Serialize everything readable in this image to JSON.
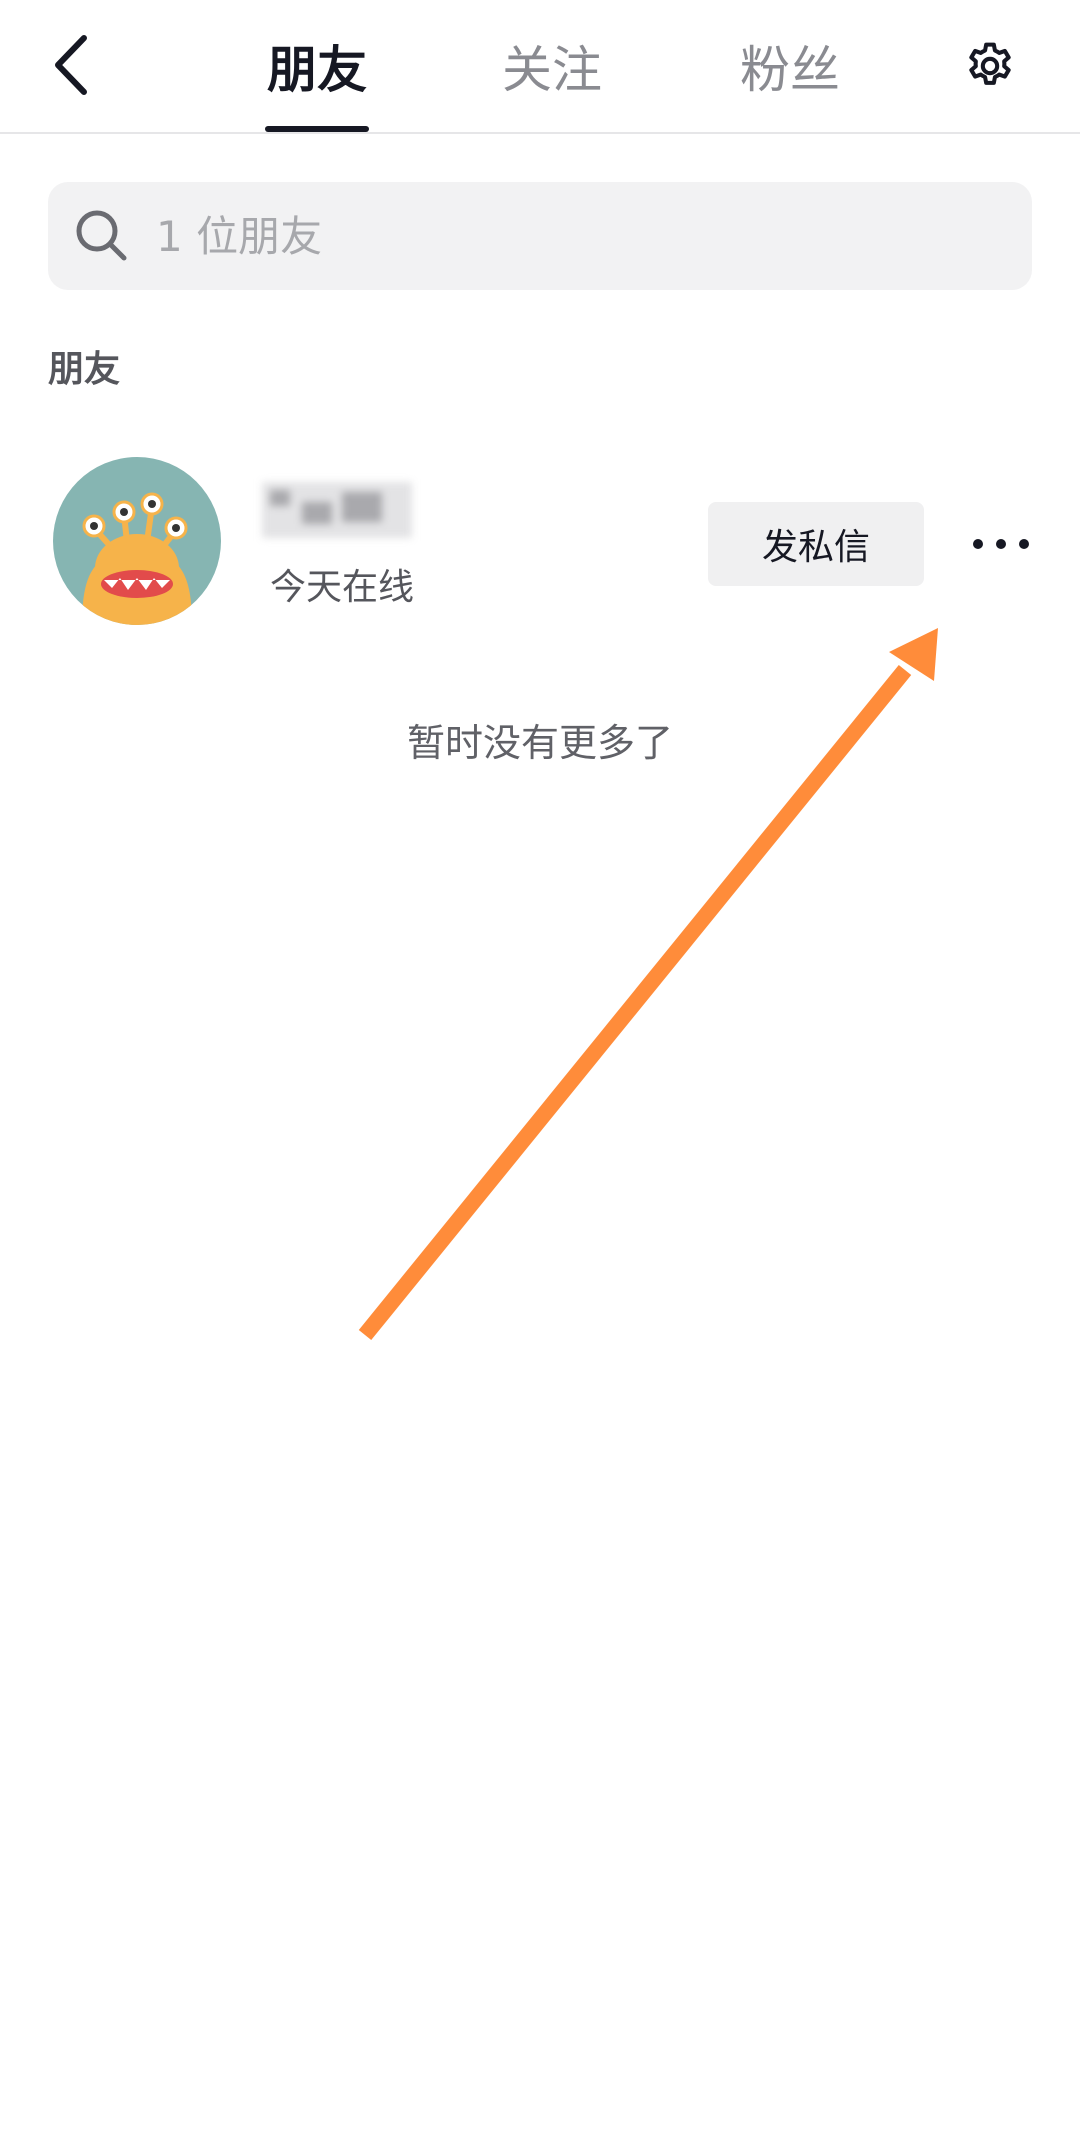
{
  "header": {
    "tabs": [
      {
        "label": "朋友",
        "active": true
      },
      {
        "label": "关注",
        "active": false
      },
      {
        "label": "粉丝",
        "active": false
      }
    ],
    "back_icon": "chevron-left-icon",
    "settings_icon": "gear-icon"
  },
  "search": {
    "placeholder": "1 位朋友",
    "value": ""
  },
  "section": {
    "title": "朋友"
  },
  "friends": [
    {
      "status": "今天在线",
      "message_label": "发私信",
      "more_icon": "more-dots-icon"
    }
  ],
  "list_end": "暂时没有更多了",
  "colors": {
    "annotation_arrow": "#ff8c3a",
    "primary_text": "#161823",
    "secondary_text": "#8a8b91",
    "search_bg": "#f2f2f3"
  }
}
